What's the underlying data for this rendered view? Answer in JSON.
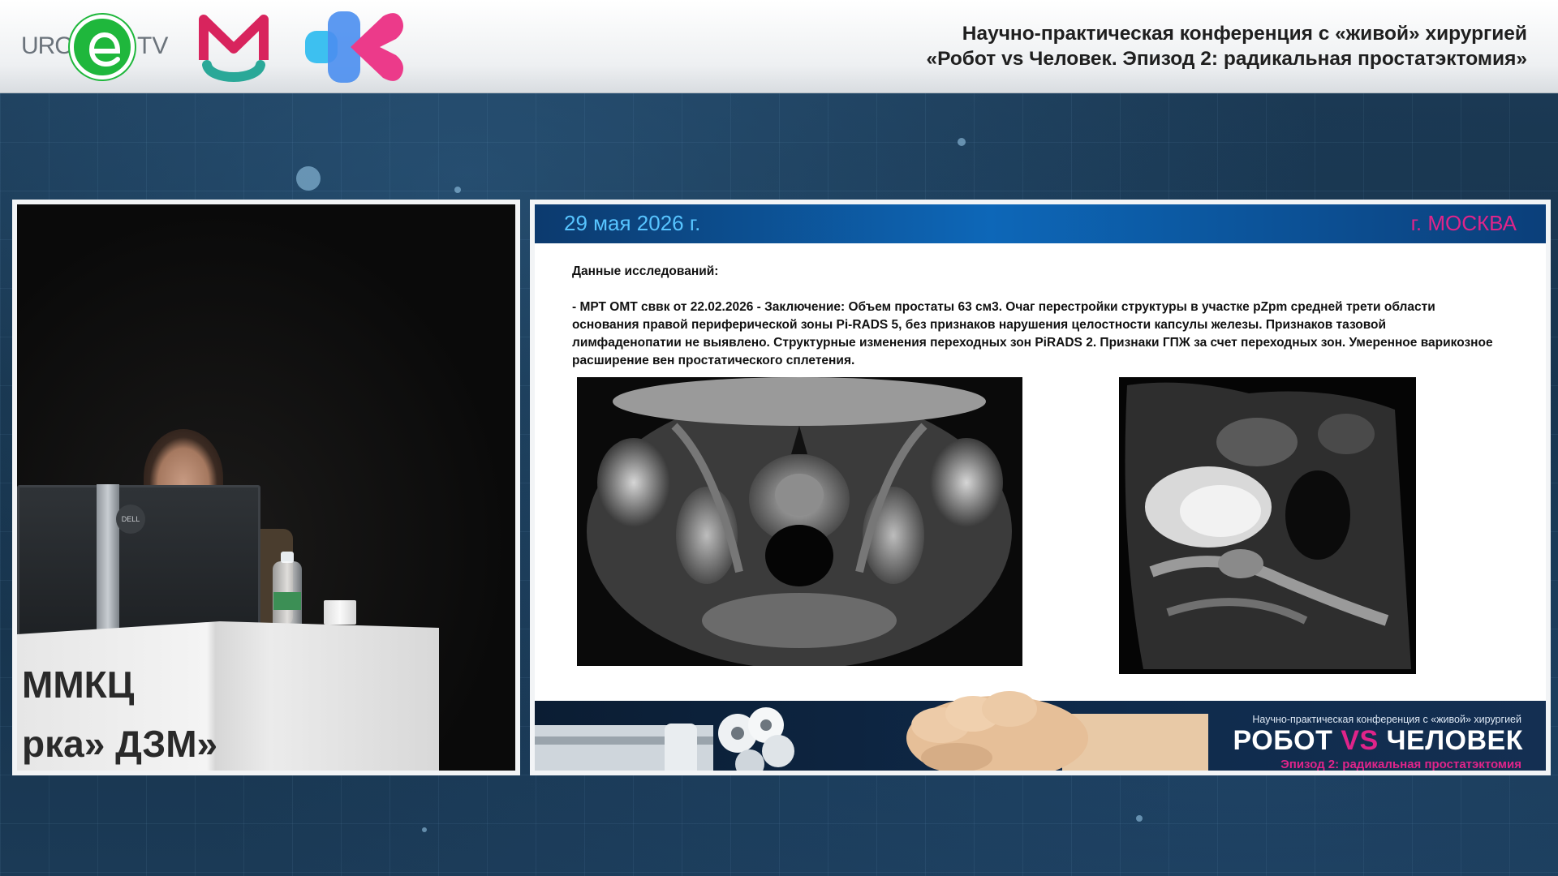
{
  "header": {
    "logo_uro_text": "URO",
    "logo_tv_text": "TV",
    "title_line1": "Научно-практическая конференция с «живой» хирургией",
    "title_line2": "«Робот vs Человек. Эпизод 2: радикальная простатэктомия»"
  },
  "camera": {
    "podium_line1": "ММКЦ",
    "podium_line2": "рка» ДЗМ»",
    "monitor_brand": "DELL"
  },
  "slide": {
    "date": "29 мая 2026 г.",
    "city": "г. МОСКВА",
    "heading": "Данные исследований:",
    "body": "- МРТ ОМТ сввк от 22.02.2026 - Заключение: Объем простаты 63 см3. Очаг перестройки структуры в участке pZpm средней трети области основания правой периферической зоны Pi-RADS 5, без признаков нарушения целостности капсулы железы. Признаков тазовой лимфаденопатии не выявлено. Структурные изменения переходных зон PiRADS 2. Признаки ГПЖ за счет переходных зон. Умеренное варикозное расширение вен простатического сплетения.",
    "banner_subtitle": "Научно-практическая конференция с «живой» хирургией",
    "banner_title_left": "РОБОТ ",
    "banner_title_vs": "VS",
    "banner_title_right": " ЧЕЛОВЕК",
    "banner_episode": "Эпизод 2: радикальная простатэктомия"
  },
  "colors": {
    "accent_blue": "#57c4ff",
    "accent_magenta": "#e0248a",
    "logo_green": "#1fb73c"
  }
}
